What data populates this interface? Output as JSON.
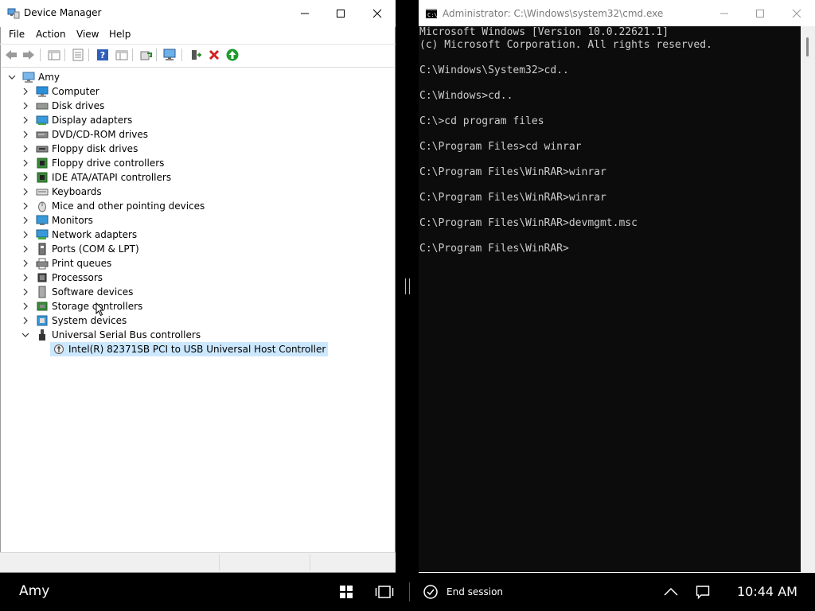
{
  "device_manager": {
    "title": "Device Manager",
    "menu": [
      "File",
      "Action",
      "View",
      "Help"
    ],
    "tree": {
      "root": "Amy",
      "categories": [
        {
          "label": "Computer",
          "icon": "computer-icon"
        },
        {
          "label": "Disk drives",
          "icon": "disk-drive-icon"
        },
        {
          "label": "Display adapters",
          "icon": "display-adapter-icon"
        },
        {
          "label": "DVD/CD-ROM drives",
          "icon": "dvd-drive-icon"
        },
        {
          "label": "Floppy disk drives",
          "icon": "floppy-disk-icon"
        },
        {
          "label": "Floppy drive controllers",
          "icon": "floppy-controller-icon"
        },
        {
          "label": "IDE ATA/ATAPI controllers",
          "icon": "ide-controller-icon"
        },
        {
          "label": "Keyboards",
          "icon": "keyboard-icon"
        },
        {
          "label": "Mice and other pointing devices",
          "icon": "mouse-icon"
        },
        {
          "label": "Monitors",
          "icon": "monitor-icon"
        },
        {
          "label": "Network adapters",
          "icon": "network-adapter-icon"
        },
        {
          "label": "Ports (COM & LPT)",
          "icon": "port-icon"
        },
        {
          "label": "Print queues",
          "icon": "printer-icon"
        },
        {
          "label": "Processors",
          "icon": "processor-icon"
        },
        {
          "label": "Software devices",
          "icon": "software-device-icon"
        },
        {
          "label": "Storage controllers",
          "icon": "storage-controller-icon"
        },
        {
          "label": "System devices",
          "icon": "system-device-icon"
        },
        {
          "label": "Universal Serial Bus controllers",
          "icon": "usb-icon"
        }
      ],
      "usb_child": "Intel(R) 82371SB PCI to USB Universal Host Controller"
    }
  },
  "cmd": {
    "title": "Administrator: C:\\Windows\\system32\\cmd.exe",
    "lines": [
      "Microsoft Windows [Version 10.0.22621.1]",
      "(c) Microsoft Corporation. All rights reserved.",
      "",
      "C:\\Windows\\System32>cd..",
      "",
      "C:\\Windows>cd..",
      "",
      "C:\\>cd program files",
      "",
      "C:\\Program Files>cd winrar",
      "",
      "C:\\Program Files\\WinRAR>winrar",
      "",
      "C:\\Program Files\\WinRAR>winrar",
      "",
      "C:\\Program Files\\WinRAR>devmgmt.msc",
      "",
      "C:\\Program Files\\WinRAR>"
    ]
  },
  "taskbar": {
    "user": "Amy",
    "end_session": "End session",
    "time": "10:44 AM"
  }
}
